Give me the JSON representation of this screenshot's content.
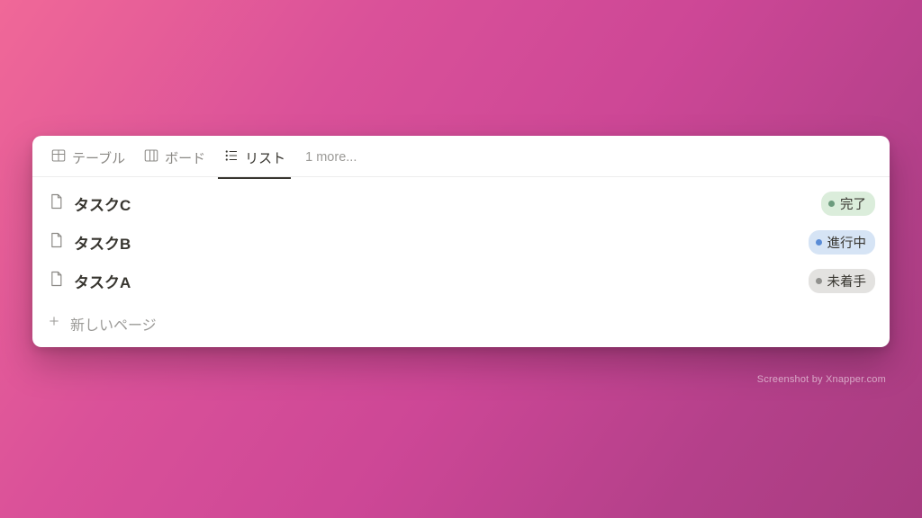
{
  "tabs": {
    "table": "テーブル",
    "board": "ボード",
    "list": "リスト",
    "more": "1 more..."
  },
  "items": [
    {
      "title": "タスクC",
      "status": "完了",
      "color": "green"
    },
    {
      "title": "タスクB",
      "status": "進行中",
      "color": "blue"
    },
    {
      "title": "タスクA",
      "status": "未着手",
      "color": "grey"
    }
  ],
  "newPage": "新しいページ",
  "watermark": "Screenshot by Xnapper.com"
}
